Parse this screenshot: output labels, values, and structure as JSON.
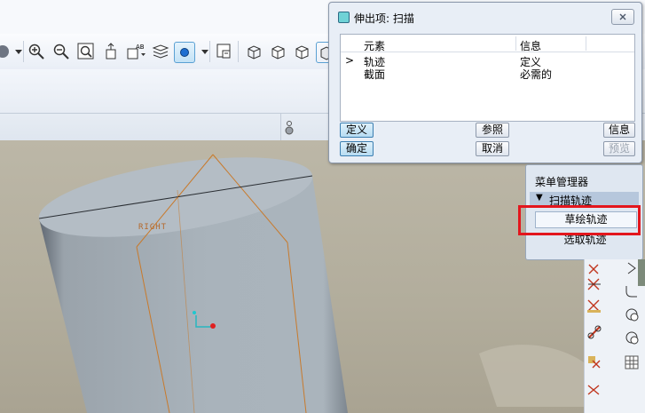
{
  "dialog": {
    "title": "伸出项: 扫描",
    "columns": [
      "元素",
      "信息"
    ],
    "rows": [
      {
        "marker": ">",
        "element": "轨迹",
        "info": "定义"
      },
      {
        "marker": "",
        "element": "截面",
        "info": "必需的"
      }
    ],
    "buttons": {
      "define": "定义",
      "reference": "参照",
      "info": "信息",
      "ok": "确定",
      "cancel": "取消",
      "preview": "预览"
    }
  },
  "menu_manager": {
    "title": "菜单管理器",
    "submenu": "扫描轨迹",
    "items": [
      "草绘轨迹",
      "选取轨迹"
    ]
  },
  "viewport": {
    "datum_label": "RIGHT"
  },
  "colors": {
    "highlight": "#e3161d",
    "toolbar_bg": "#eef2f8",
    "viewport_bg": "#b4b0a2",
    "dialog_bg": "#e8eef6"
  },
  "icons": [
    "zoom-in-icon",
    "zoom-out-icon",
    "zoom-fit-icon",
    "orient-icon",
    "saved-views-icon",
    "layers-icon",
    "display-style-icon",
    "model-display-icon",
    "solid-cube-icon"
  ]
}
